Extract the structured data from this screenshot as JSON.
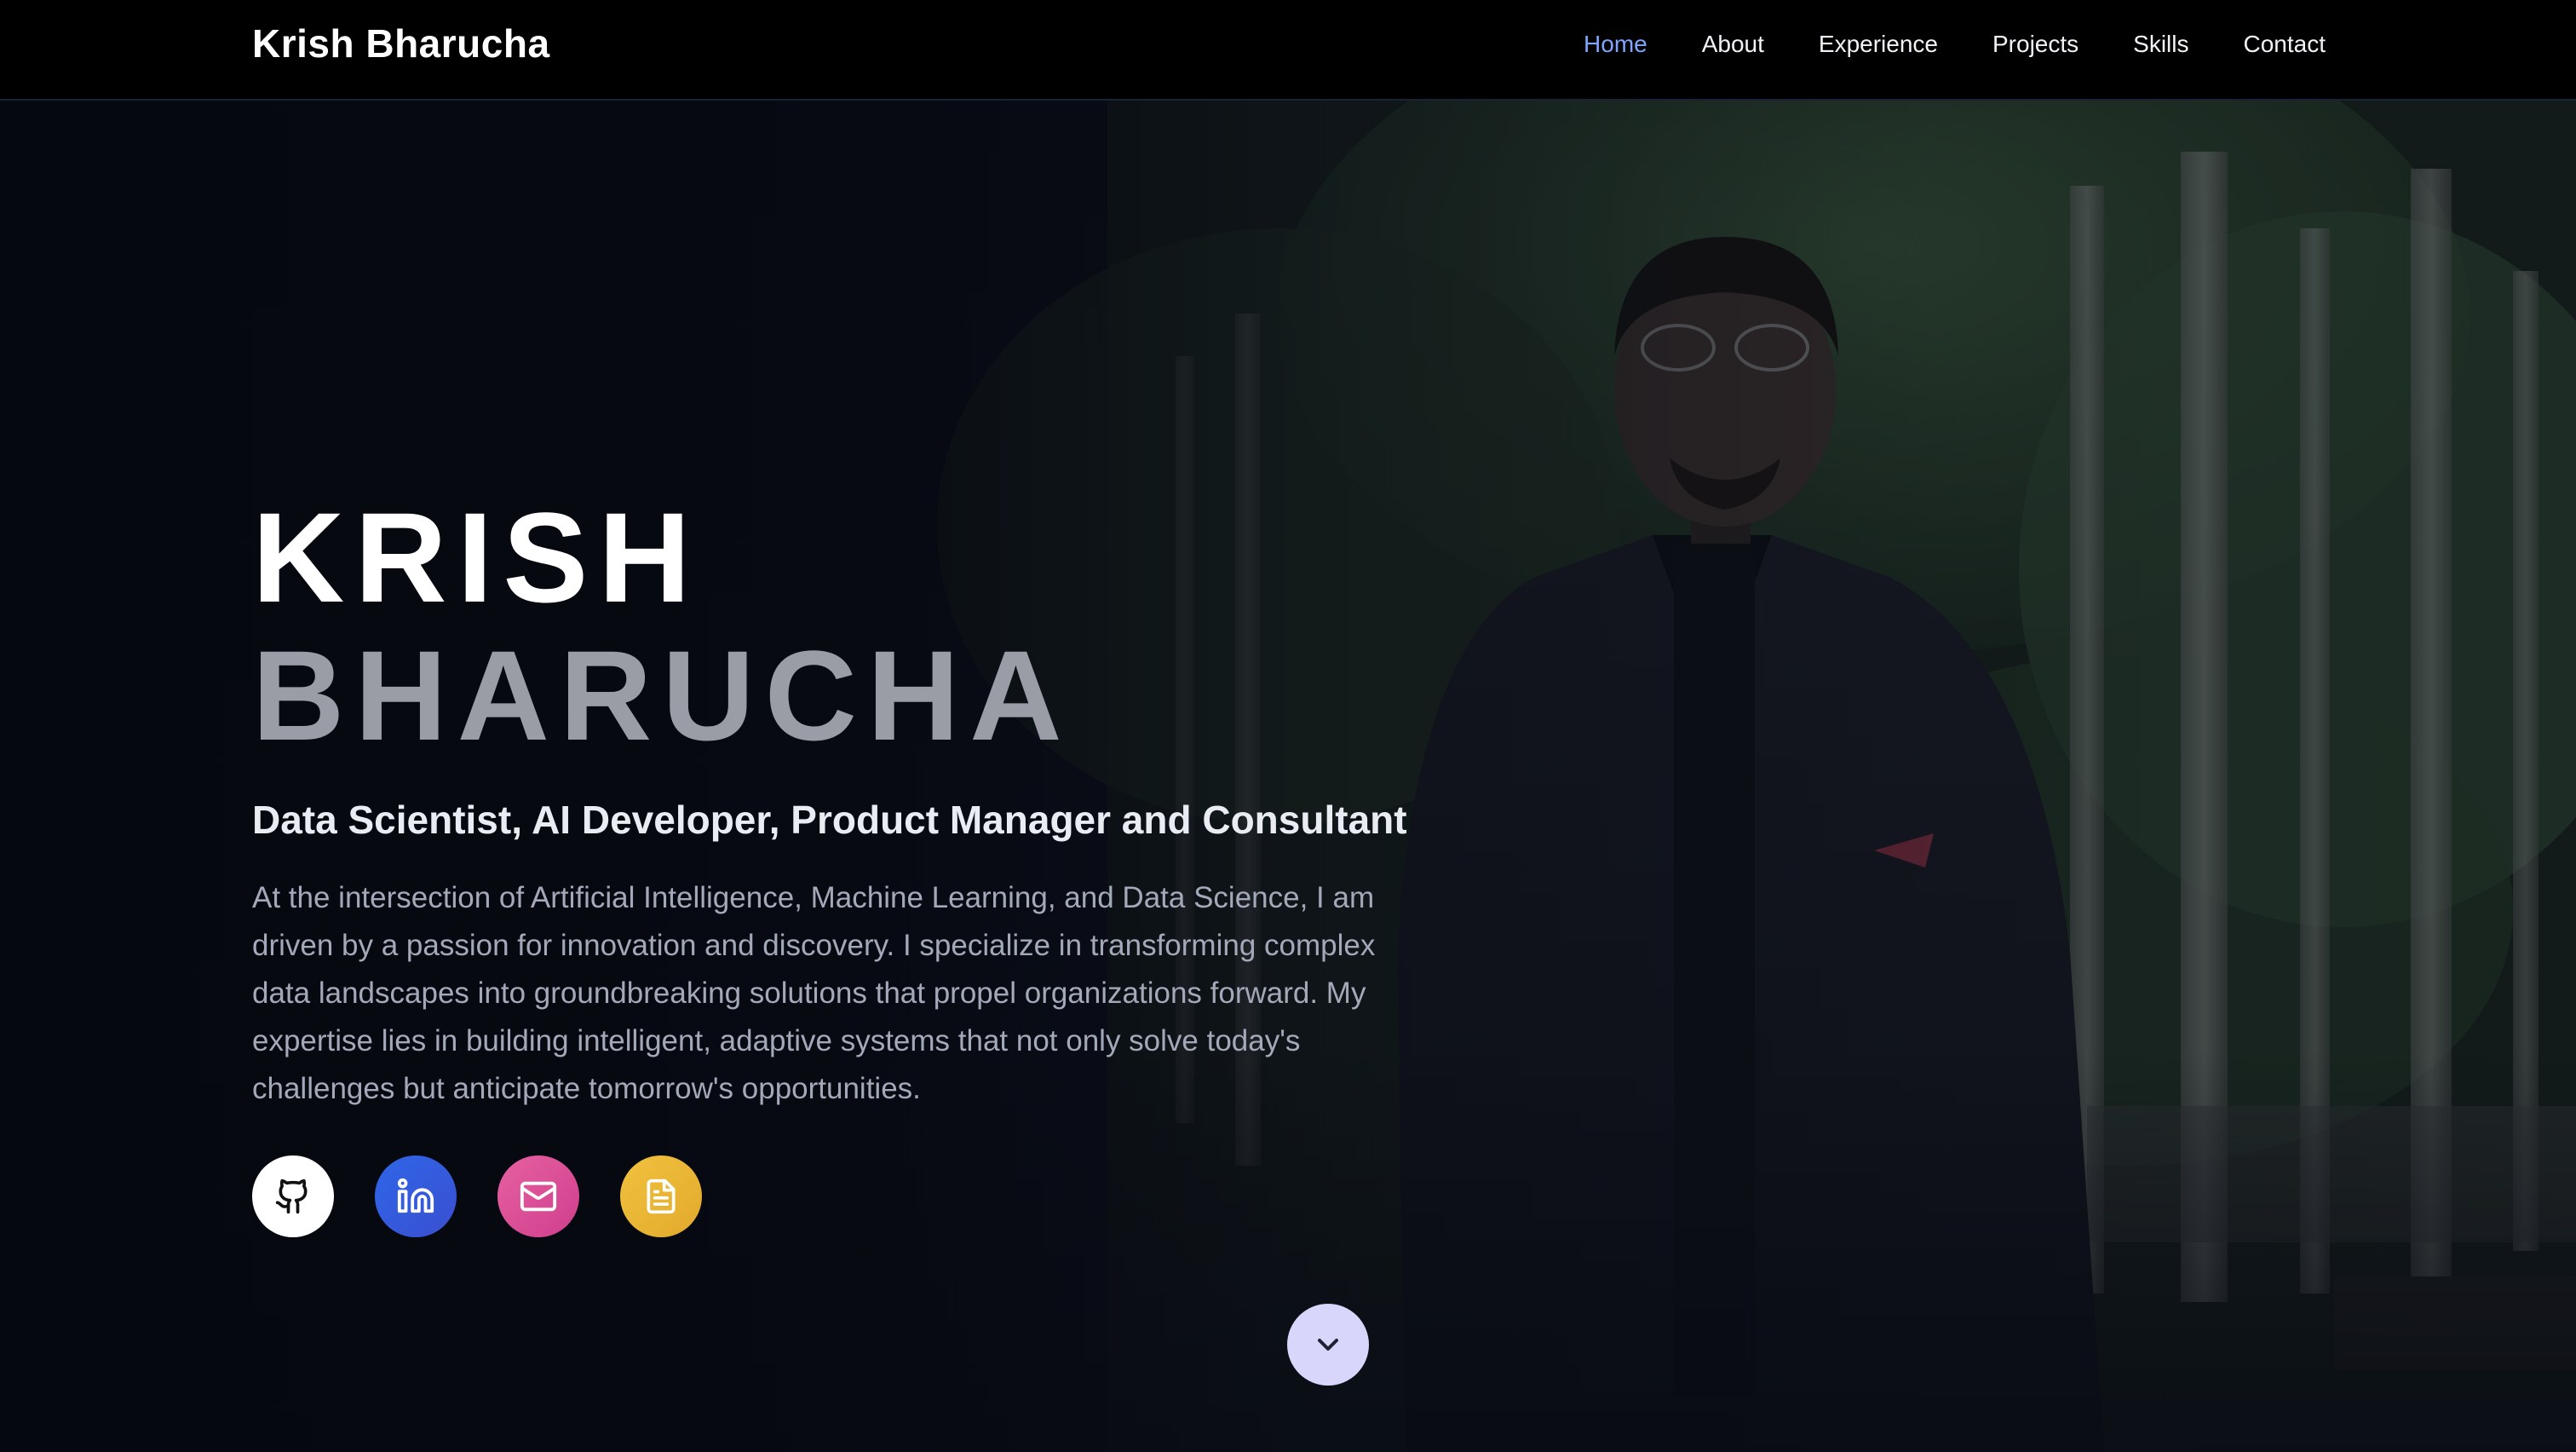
{
  "brand": "Krish Bharucha",
  "nav": {
    "items": [
      {
        "label": "Home",
        "active": true
      },
      {
        "label": "About",
        "active": false
      },
      {
        "label": "Experience",
        "active": false
      },
      {
        "label": "Projects",
        "active": false
      },
      {
        "label": "Skills",
        "active": false
      },
      {
        "label": "Contact",
        "active": false
      }
    ]
  },
  "hero": {
    "first_name": "KRISH",
    "last_name": "BHARUCHA",
    "subtitle": "Data Scientist, AI Developer, Product Manager and Consultant",
    "bio": "At the intersection of Artificial Intelligence, Machine Learning, and Data Science, I am driven by a passion for innovation and discovery. I specialize in transforming complex data landscapes into groundbreaking solutions that propel organizations forward. My expertise lies in building intelligent, adaptive systems that not only solve today's challenges but anticipate tomorrow's opportunities."
  },
  "socials": [
    {
      "icon": "github-icon",
      "color": "#ffffff"
    },
    {
      "icon": "linkedin-icon",
      "color": "#2f66e8"
    },
    {
      "icon": "mail-icon",
      "color": "#e760a2"
    },
    {
      "icon": "document-icon",
      "color": "#f2c23e"
    }
  ],
  "scroll_icon": "chevron-down-icon",
  "colors": {
    "nav_active": "#7fa6ff",
    "background": "#05070d",
    "accent_scroll": "#d9d6fb"
  }
}
